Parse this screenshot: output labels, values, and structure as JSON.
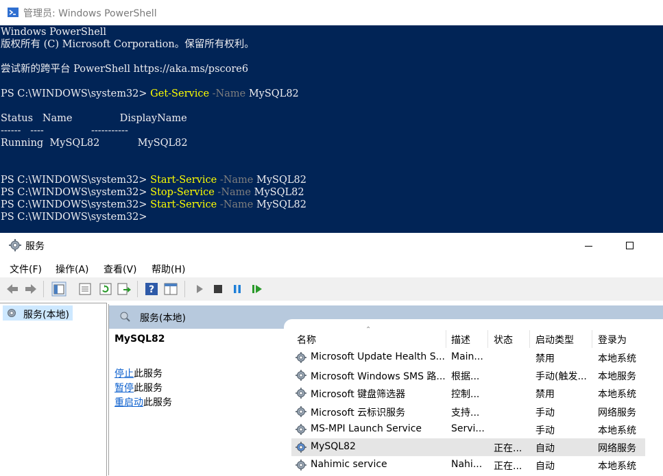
{
  "powershell": {
    "title": "管理员: Windows PowerShell",
    "lines": [
      {
        "text": "Windows PowerShell"
      },
      {
        "text": "版权所有 (C) Microsoft Corporation。保留所有权利。"
      },
      {
        "text": ""
      },
      {
        "text": "尝试新的跨平台 PowerShell https://aka.ms/pscore6"
      },
      {
        "text": ""
      },
      {
        "prompt": "PS C:\\WINDOWS\\system32> ",
        "cmd": "Get-Service",
        "param": " -Name",
        "arg": " MySQL82"
      },
      {
        "text": ""
      },
      {
        "text": "Status   Name               DisplayName"
      },
      {
        "text": "------   ----               -----------"
      },
      {
        "text": "Running  MySQL82            MySQL82"
      },
      {
        "text": ""
      },
      {
        "text": ""
      },
      {
        "prompt": "PS C:\\WINDOWS\\system32> ",
        "cmd": "Start-Service",
        "param": " -Name",
        "arg": " MySQL82"
      },
      {
        "prompt": "PS C:\\WINDOWS\\system32> ",
        "cmd": "Stop-Service",
        "param": " -Name",
        "arg": " MySQL82"
      },
      {
        "prompt": "PS C:\\WINDOWS\\system32> ",
        "cmd": "Start-Service",
        "param": " -Name",
        "arg": " MySQL82"
      },
      {
        "prompt": "PS C:\\WINDOWS\\system32>",
        "cmd": "",
        "param": "",
        "arg": ""
      }
    ],
    "colors": {
      "background": "#012456",
      "text": "#eeedf0",
      "command": "#ffff00",
      "parameter": "#7e7e7e"
    }
  },
  "services": {
    "title": "服务",
    "menu": [
      "文件(F)",
      "操作(A)",
      "查看(V)",
      "帮助(H)"
    ],
    "toolbar": [
      "back-arrow-icon",
      "forward-arrow-icon",
      "console-tree-icon",
      "properties-icon",
      "refresh-icon",
      "export-icon",
      "help-icon",
      "show-hide-pane-icon",
      "start-service-icon",
      "stop-service-icon",
      "pause-service-icon",
      "resume-service-icon"
    ],
    "tree_label": "服务(本地)",
    "header_label": "服务(本地)",
    "detail": {
      "name": "MySQL82",
      "actions": [
        {
          "link": "停止",
          "suffix": "此服务"
        },
        {
          "link": "暂停",
          "suffix": "此服务"
        },
        {
          "link": "重启动",
          "suffix": "此服务"
        }
      ]
    },
    "columns": [
      "名称",
      "描述",
      "状态",
      "启动类型",
      "登录为"
    ],
    "rows": [
      {
        "name": "Microsoft Update Health S...",
        "desc": "Main...",
        "status": "",
        "startup": "禁用",
        "logon": "本地系统"
      },
      {
        "name": "Microsoft Windows SMS 路...",
        "desc": "根据...",
        "status": "",
        "startup": "手动(触发...",
        "logon": "本地服务"
      },
      {
        "name": "Microsoft 键盘筛选器",
        "desc": "控制...",
        "status": "",
        "startup": "禁用",
        "logon": "本地系统"
      },
      {
        "name": "Microsoft 云标识服务",
        "desc": "支持...",
        "status": "",
        "startup": "手动",
        "logon": "网络服务"
      },
      {
        "name": "MS-MPI Launch Service",
        "desc": "Servi...",
        "status": "",
        "startup": "手动",
        "logon": "本地系统"
      },
      {
        "name": "MySQL82",
        "desc": "",
        "status": "正在...",
        "startup": "自动",
        "logon": "网络服务",
        "selected": true
      },
      {
        "name": "Nahimic service",
        "desc": "Nahi...",
        "status": "正在...",
        "startup": "自动",
        "logon": "本地系统"
      }
    ],
    "colors": {
      "link": "#0b5fce",
      "header_band": "#b7c9dd",
      "selection": "#e5e5e5",
      "tree_selection": "#cde8ff"
    }
  }
}
